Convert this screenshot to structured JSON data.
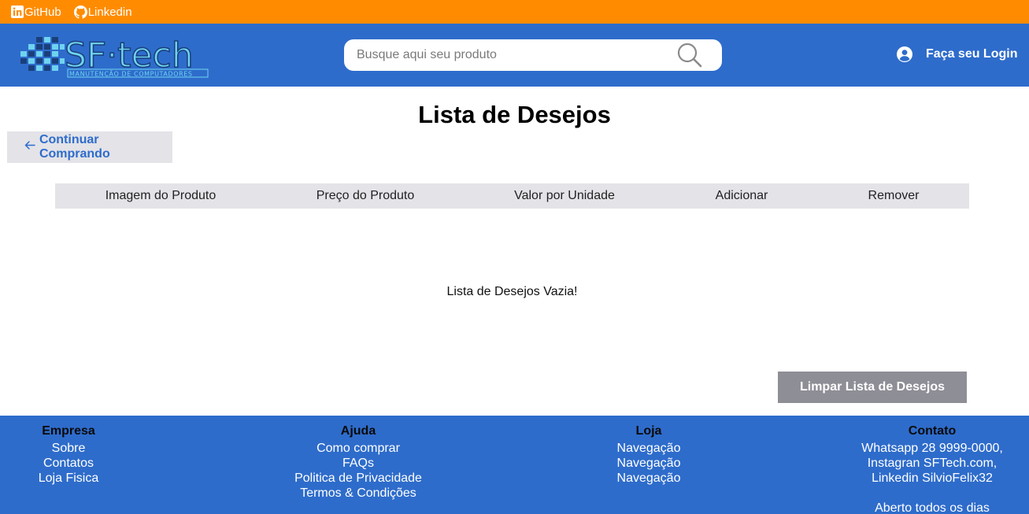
{
  "topbar": {
    "links": [
      {
        "label": "GitHub",
        "icon": "linkedin-icon"
      },
      {
        "label": "Linkedin",
        "icon": "github-icon"
      }
    ]
  },
  "header": {
    "logo_text": "SF·tech",
    "logo_subtitle": "MANUTENÇÃO DE COMPUTADORES",
    "search_placeholder": "Busque aqui seu produto",
    "search_icon": "search-icon",
    "login_label": "Faça seu Login",
    "login_icon": "user-circle-icon"
  },
  "main": {
    "title": "Lista de Desejos",
    "continue_label": "Continuar Comprando",
    "continue_icon": "arrow-left-icon",
    "columns": [
      "Imagem do Produto",
      "Preço do Produto",
      "Valor por Unidade",
      "Adicionar",
      "Remover"
    ],
    "empty_message": "Lista de Desejos Vazia!",
    "clear_label": "Limpar Lista de Desejos"
  },
  "footer": {
    "empresa": {
      "title": "Empresa",
      "links": [
        "Sobre",
        "Contatos",
        "Loja Fisica"
      ]
    },
    "ajuda": {
      "title": "Ajuda",
      "links": [
        "Como comprar",
        "FAQs",
        "Politica de Privacidade",
        "Termos & Condições"
      ]
    },
    "loja": {
      "title": "Loja",
      "links": [
        "Navegação",
        "Navegação",
        "Navegação"
      ]
    },
    "contato": {
      "title": "Contato",
      "lines": [
        "Whatsapp 28 9999-0000,",
        "Instagran SFTech.com,",
        "Linkedin SilvioFelix32"
      ],
      "hours": "Aberto todos os dias"
    }
  },
  "colors": {
    "topbar": "#FF8C00",
    "brand_blue": "#2E6CCB",
    "light_gray": "#E3E3E8",
    "button_gray": "#8E8E96",
    "logo_cyan": "#6FD3F0"
  }
}
